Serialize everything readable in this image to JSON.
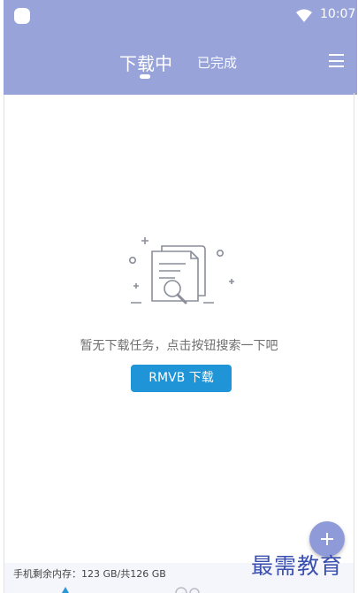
{
  "status_bar": {
    "time": "10:07",
    "icons": [
      "app-circle-icon",
      "wifi-icon"
    ]
  },
  "tabs": [
    {
      "label": "下载中",
      "active": true
    },
    {
      "label": "已完成",
      "active": false
    }
  ],
  "menu": {
    "icon": "menu-icon"
  },
  "empty_state": {
    "icon": "document-search-icon",
    "message": "暂无下载任务，点击按钮搜索一下吧",
    "button_label": "RMVB 下载"
  },
  "fab": {
    "icon": "plus-icon"
  },
  "storage": {
    "text": "手机剩余内存：123 GB/共126 GB"
  },
  "watermark": {
    "text": "最需教育"
  },
  "colors": {
    "appbar": "#97a3d9",
    "button": "#1f95d8",
    "fab": "#8f9ad8",
    "watermark": "#3a4fb0"
  }
}
